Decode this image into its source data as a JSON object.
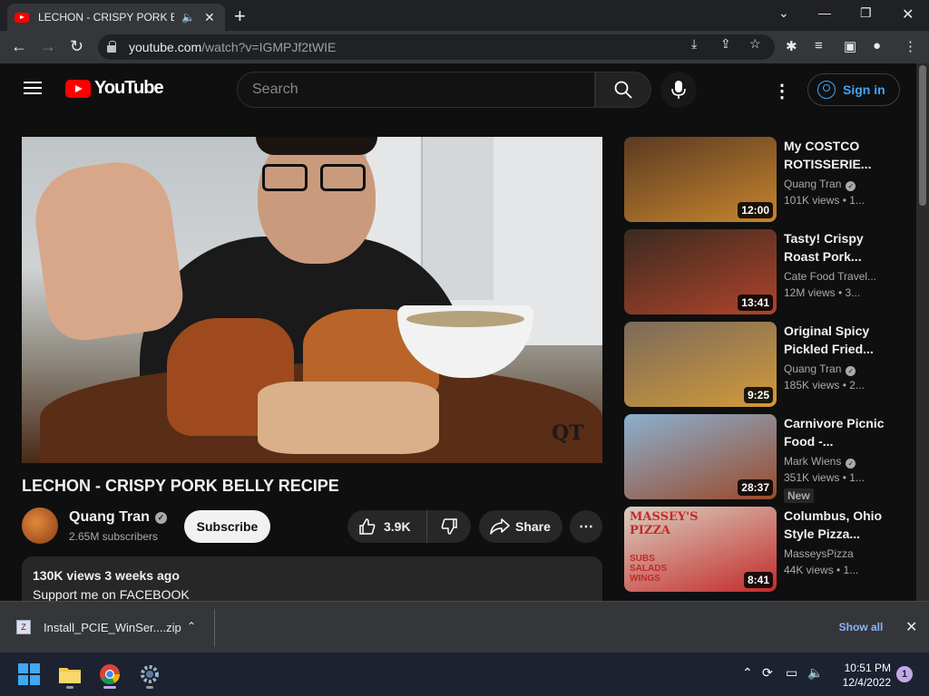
{
  "browser": {
    "tab_title": "LECHON - CRISPY PORK BELLY RECIPE - YouTube",
    "new_tab_label": "+",
    "url_host": "youtube.com",
    "url_path": "/watch?v=IGMPJf2tWIE"
  },
  "youtube": {
    "logo_text": "YouTube",
    "search_placeholder": "Search",
    "sign_in_label": "Sign in"
  },
  "video": {
    "title": "LECHON - CRISPY PORK BELLY RECIPE",
    "watermark": "QT",
    "channel_name": "Quang Tran",
    "subscribers": "2.65M subscribers",
    "subscribe_label": "Subscribe",
    "likes": "3.9K",
    "share_label": "Share",
    "views_and_date": "130K views  3 weeks ago",
    "description_line": "Support me on FACEBOOK"
  },
  "recommendations": [
    {
      "title": "My COSTCO ROTISSERIE...",
      "channel": "Quang Tran",
      "verified": true,
      "meta": "101K views  • 1...",
      "duration": "12:00",
      "new": false,
      "colors": [
        "#5a3a22",
        "#c7852e"
      ]
    },
    {
      "title": "Tasty!  Crispy Roast Pork...",
      "channel": "Cate Food Travel...",
      "verified": false,
      "meta": "12M views  • 3...",
      "duration": "13:41",
      "new": false,
      "colors": [
        "#3a2a20",
        "#b0442a"
      ]
    },
    {
      "title": "Original Spicy Pickled Fried...",
      "channel": "Quang Tran",
      "verified": true,
      "meta": "185K views  • 2...",
      "duration": "9:25",
      "new": false,
      "colors": [
        "#7a6a5a",
        "#d39a3a"
      ]
    },
    {
      "title": "Carnivore Picnic Food -...",
      "channel": "Mark Wiens",
      "verified": true,
      "meta": "351K views  • 1...",
      "duration": "28:37",
      "new": true,
      "new_label": "New",
      "colors": [
        "#8ab0d0",
        "#9a4a2a"
      ]
    },
    {
      "title": "Columbus, Ohio Style Pizza...",
      "channel": "MasseysPizza",
      "verified": false,
      "meta": "44K views  • 1...",
      "duration": "8:41",
      "new": false,
      "colors": [
        "#d8d0c0",
        "#c42a2a"
      ],
      "sign_text": "MASSEY'S PIZZA",
      "sign_sub": "SUBS SALADS WINGS"
    }
  ],
  "downloads": {
    "file_name": "Install_PCIE_WinSer....zip",
    "show_all_label": "Show all"
  },
  "taskbar": {
    "time": "10:51 PM",
    "date": "12/4/2022",
    "notification_count": "1"
  }
}
